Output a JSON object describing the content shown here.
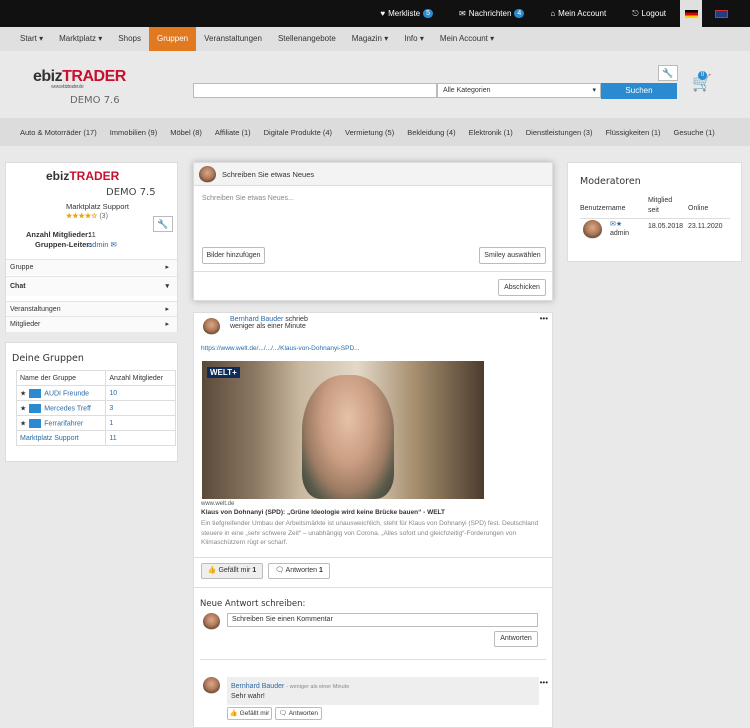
{
  "topbar": {
    "items": [
      {
        "icon": "heart-icon",
        "label": "Merkliste",
        "count": "5"
      },
      {
        "icon": "envelope-icon",
        "label": "Nachrichten",
        "count": "4"
      },
      {
        "icon": "home-icon",
        "label": "Mein Account"
      },
      {
        "icon": "logout-icon",
        "label": "Logout"
      }
    ]
  },
  "nav": {
    "items": [
      "Start ▾",
      "Marktplatz ▾",
      "Shops",
      "Gruppen",
      "Veranstaltungen",
      "Stellenangebote",
      "Magazin ▾",
      "Info ▾",
      "Mein Account ▾"
    ],
    "active": "Gruppen"
  },
  "header": {
    "logo_left": "ebiz",
    "logo_right": "TRADER",
    "logo_sub": "www.ebiztrader.de",
    "demo": "DEMO 7.6",
    "search_placeholder": "",
    "category": "Alle Kategorien",
    "search_btn": "Suchen",
    "cart_count": "0"
  },
  "categories": [
    "Auto & Motorräder (17)",
    "Immobilien (9)",
    "Möbel (8)",
    "Affiliate (1)",
    "Digitale Produkte (4)",
    "Vermietung (5)",
    "Bekleidung (4)",
    "Elektronik (1)",
    "Dienstleistungen (3)",
    "Flüssigkeiten (1)",
    "Gesuche (1)"
  ],
  "group": {
    "logo_left": "ebiz",
    "logo_right": "TRADER",
    "demo": "DEMO 7.5",
    "name": "Marktplatz Support",
    "stars": "★★★★☆",
    "rating_count": "(3)",
    "members_label": "Anzahl Mitglieder:",
    "members": "11",
    "leader_label": "Gruppen-Leiter:",
    "leader": "admin",
    "sections": [
      "Gruppe",
      "Chat",
      "Veranstaltungen",
      "Mitglieder"
    ]
  },
  "my_groups": {
    "title": "Deine Gruppen",
    "col1": "Name der Gruppe",
    "col2": "Anzahl Mitglieder",
    "rows": [
      {
        "name": "AUDI Freunde",
        "count": "10"
      },
      {
        "name": "Mercedes Treff",
        "count": "3"
      },
      {
        "name": "Ferrarifahrer",
        "count": "1"
      },
      {
        "name": "Marktplatz Support",
        "count": "11"
      }
    ]
  },
  "composer": {
    "header": "Schreiben Sie etwas Neues",
    "placeholder": "Schreiben Sie etwas Neues...",
    "add_images": "Bilder hinzufügen",
    "smiley": "Smiley auswählen",
    "send": "Abschicken"
  },
  "post": {
    "author": "Bernhard Bauder",
    "verb": "schrieb",
    "time": "weniger als einer Minute",
    "link": "https://www.welt.de/.../.../.../Klaus-von-Dohnanyi-SPD...",
    "img_label": "WELT+",
    "source": "www.welt.de",
    "title": "Klaus von Dohnanyi (SPD): „Grüne Ideologie wird keine Brücke bauen“ - WELT",
    "text": "Ein tiefgreifender Umbau der Arbeitsmärkte ist unausweichlich, steht für Klaus von Dohnanyi (SPD) fest. Deutschland steuere in eine „sehr schwere Zeit“ – unabhängig von Corona. „Alles sofort und gleichzeitig“-Forderungen von Klimaschützern rügt er scharf.",
    "like": "Gefällt mir",
    "like_count": "1",
    "answers": "Antworten",
    "answer_count": "1",
    "reply_title": "Neue Antwort schreiben:",
    "reply_placeholder": "Schreiben Sie einen Kommentar",
    "reply_btn": "Antworten",
    "comment": {
      "author": "Bernhard Bauder",
      "time": "- weniger als einer Minute",
      "text": "Sehr wahr!",
      "like": "Gefällt mir",
      "answers": "Antworten"
    }
  },
  "moderators": {
    "title": "Moderatoren",
    "col_user": "Benutzername",
    "col_since": "Mitglied seit",
    "col_online": "Online",
    "user": "admin",
    "since": "18.05.2018",
    "online": "23.11.2020"
  }
}
